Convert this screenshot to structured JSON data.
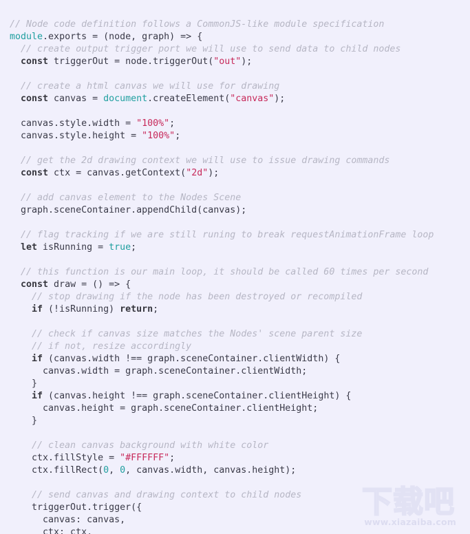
{
  "editor": {
    "language": "javascript",
    "background_color": "#f1f0fc",
    "default_text_color": "#3a3a48",
    "comment_color": "#b6b6c4",
    "keyword_color": "#37373f",
    "builtin_color": "#1f9f9f",
    "string_color": "#c7295a",
    "number_color": "#1f9f9f",
    "font_size_px": 13.3,
    "line_height_px": 18
  },
  "code": {
    "lines": [
      [
        {
          "t": "cmt",
          "s": "// Node code definition follows a CommonJS-like module specification"
        }
      ],
      [
        {
          "t": "bi",
          "s": "module"
        },
        {
          "t": "pln",
          "s": ".exports = (node, graph) => {"
        }
      ],
      [
        {
          "t": "cmt",
          "s": "  // create output trigger port we will use to send data to child nodes"
        }
      ],
      [
        {
          "t": "pln",
          "s": "  "
        },
        {
          "t": "kw",
          "s": "const"
        },
        {
          "t": "pln",
          "s": " triggerOut = node.triggerOut("
        },
        {
          "t": "str",
          "s": "\"out\""
        },
        {
          "t": "pln",
          "s": ");"
        }
      ],
      [
        {
          "t": "pln",
          "s": ""
        }
      ],
      [
        {
          "t": "cmt",
          "s": "  // create a html canvas we will use for drawing"
        }
      ],
      [
        {
          "t": "pln",
          "s": "  "
        },
        {
          "t": "kw",
          "s": "const"
        },
        {
          "t": "pln",
          "s": " canvas = "
        },
        {
          "t": "bi",
          "s": "document"
        },
        {
          "t": "pln",
          "s": ".createElement("
        },
        {
          "t": "str",
          "s": "\"canvas\""
        },
        {
          "t": "pln",
          "s": ");"
        }
      ],
      [
        {
          "t": "pln",
          "s": ""
        }
      ],
      [
        {
          "t": "pln",
          "s": "  canvas.style.width = "
        },
        {
          "t": "str",
          "s": "\"100%\""
        },
        {
          "t": "pln",
          "s": ";"
        }
      ],
      [
        {
          "t": "pln",
          "s": "  canvas.style.height = "
        },
        {
          "t": "str",
          "s": "\"100%\""
        },
        {
          "t": "pln",
          "s": ";"
        }
      ],
      [
        {
          "t": "pln",
          "s": ""
        }
      ],
      [
        {
          "t": "cmt",
          "s": "  // get the 2d drawing context we will use to issue drawing commands"
        }
      ],
      [
        {
          "t": "pln",
          "s": "  "
        },
        {
          "t": "kw",
          "s": "const"
        },
        {
          "t": "pln",
          "s": " ctx = canvas.getContext("
        },
        {
          "t": "str",
          "s": "\"2d\""
        },
        {
          "t": "pln",
          "s": ");"
        }
      ],
      [
        {
          "t": "pln",
          "s": ""
        }
      ],
      [
        {
          "t": "cmt",
          "s": "  // add canvas element to the Nodes Scene"
        }
      ],
      [
        {
          "t": "pln",
          "s": "  graph.sceneContainer.appendChild(canvas);"
        }
      ],
      [
        {
          "t": "pln",
          "s": ""
        }
      ],
      [
        {
          "t": "cmt",
          "s": "  // flag tracking if we are still runing to break requestAnimationFrame loop"
        }
      ],
      [
        {
          "t": "pln",
          "s": "  "
        },
        {
          "t": "kw",
          "s": "let"
        },
        {
          "t": "pln",
          "s": " isRunning = "
        },
        {
          "t": "bi",
          "s": "true"
        },
        {
          "t": "pln",
          "s": ";"
        }
      ],
      [
        {
          "t": "pln",
          "s": ""
        }
      ],
      [
        {
          "t": "cmt",
          "s": "  // this function is our main loop, it should be called 60 times per second"
        }
      ],
      [
        {
          "t": "pln",
          "s": "  "
        },
        {
          "t": "kw",
          "s": "const"
        },
        {
          "t": "pln",
          "s": " draw = () => {"
        }
      ],
      [
        {
          "t": "cmt",
          "s": "    // stop drawing if the node has been destroyed or recompiled"
        }
      ],
      [
        {
          "t": "pln",
          "s": "    "
        },
        {
          "t": "kw",
          "s": "if"
        },
        {
          "t": "pln",
          "s": " (!isRunning) "
        },
        {
          "t": "kw",
          "s": "return"
        },
        {
          "t": "pln",
          "s": ";"
        }
      ],
      [
        {
          "t": "pln",
          "s": ""
        }
      ],
      [
        {
          "t": "cmt",
          "s": "    // check if canvas size matches the Nodes' scene parent size"
        }
      ],
      [
        {
          "t": "cmt",
          "s": "    // if not, resize accordingly"
        }
      ],
      [
        {
          "t": "pln",
          "s": "    "
        },
        {
          "t": "kw",
          "s": "if"
        },
        {
          "t": "pln",
          "s": " (canvas.width !== graph.sceneContainer.clientWidth) {"
        }
      ],
      [
        {
          "t": "pln",
          "s": "      canvas.width = graph.sceneContainer.clientWidth;"
        }
      ],
      [
        {
          "t": "pln",
          "s": "    }"
        }
      ],
      [
        {
          "t": "pln",
          "s": "    "
        },
        {
          "t": "kw",
          "s": "if"
        },
        {
          "t": "pln",
          "s": " (canvas.height !== graph.sceneContainer.clientHeight) {"
        }
      ],
      [
        {
          "t": "pln",
          "s": "      canvas.height = graph.sceneContainer.clientHeight;"
        }
      ],
      [
        {
          "t": "pln",
          "s": "    }"
        }
      ],
      [
        {
          "t": "pln",
          "s": ""
        }
      ],
      [
        {
          "t": "cmt",
          "s": "    // clean canvas background with white color"
        }
      ],
      [
        {
          "t": "pln",
          "s": "    ctx.fillStyle = "
        },
        {
          "t": "str",
          "s": "\"#FFFFFF\""
        },
        {
          "t": "pln",
          "s": ";"
        }
      ],
      [
        {
          "t": "pln",
          "s": "    ctx.fillRect("
        },
        {
          "t": "num",
          "s": "0"
        },
        {
          "t": "pln",
          "s": ", "
        },
        {
          "t": "num",
          "s": "0"
        },
        {
          "t": "pln",
          "s": ", canvas.width, canvas.height);"
        }
      ],
      [
        {
          "t": "pln",
          "s": ""
        }
      ],
      [
        {
          "t": "cmt",
          "s": "    // send canvas and drawing context to child nodes"
        }
      ],
      [
        {
          "t": "pln",
          "s": "    triggerOut.trigger({"
        }
      ],
      [
        {
          "t": "pln",
          "s": "      canvas: canvas,"
        }
      ],
      [
        {
          "t": "pln",
          "s": "      ctx: ctx,"
        }
      ]
    ]
  },
  "watermark": {
    "brand_cjk": "下载吧",
    "url": "www.xiazaiba.com",
    "color": "#e2e2f4"
  }
}
